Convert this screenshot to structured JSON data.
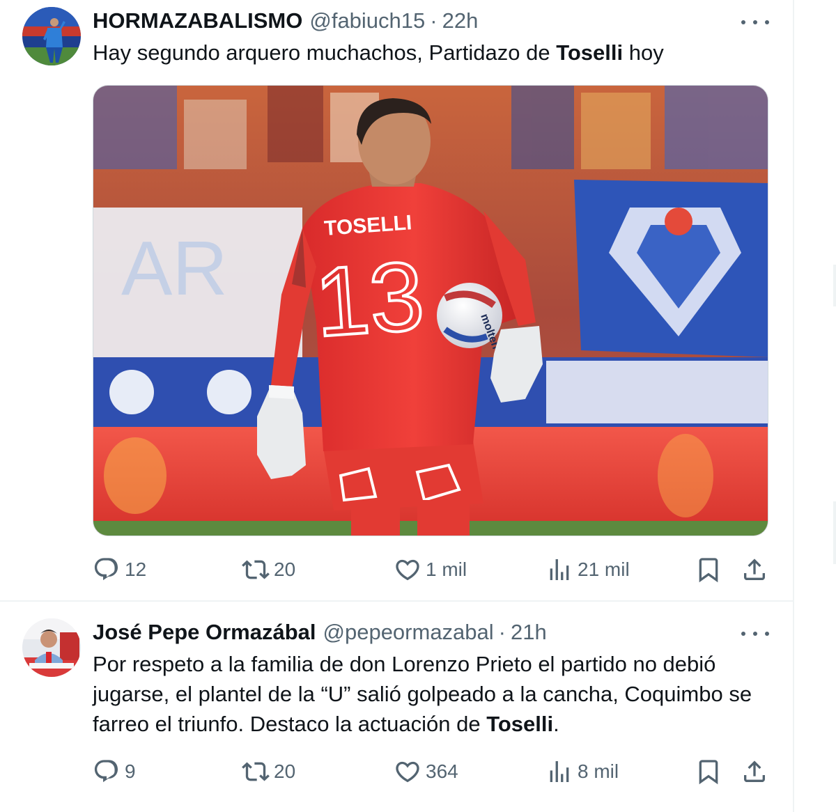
{
  "tweets": [
    {
      "author_name": "HORMAZABALISMO",
      "handle": "@fabiuch15",
      "separator": "·",
      "time": "22h",
      "text_before": "Hay segundo arquero muchachos, Partidazo de ",
      "text_bold": "Toselli",
      "text_after": " hoy",
      "media": {
        "jersey_name": "TOSELLI",
        "jersey_number": "13",
        "ball_brand": "molten"
      },
      "stats": {
        "replies": "12",
        "reposts": "20",
        "likes": "1 mil",
        "views": "21 mil"
      }
    },
    {
      "author_name": "José Pepe Ormazábal",
      "handle": "@pepeormazabal",
      "separator": "·",
      "time": "21h",
      "text_before": "Por respeto a la familia de don Lorenzo Prieto el partido no debió jugarse, el plantel de la “U” salió golpeado a la cancha, Coquimbo se farreo el triunfo. Destaco la actuación de ",
      "text_bold": "Toselli",
      "text_after": ".",
      "stats": {
        "replies": "9",
        "reposts": "20",
        "likes": "364",
        "views": "8 mil"
      }
    }
  ],
  "colors": {
    "text_primary": "#0f1419",
    "text_secondary": "#536471",
    "divider": "#eff3f4",
    "jersey_red": "#e8332d"
  },
  "icons": [
    "reply-icon",
    "repost-icon",
    "like-icon",
    "views-icon",
    "bookmark-icon",
    "share-icon",
    "more-icon"
  ]
}
